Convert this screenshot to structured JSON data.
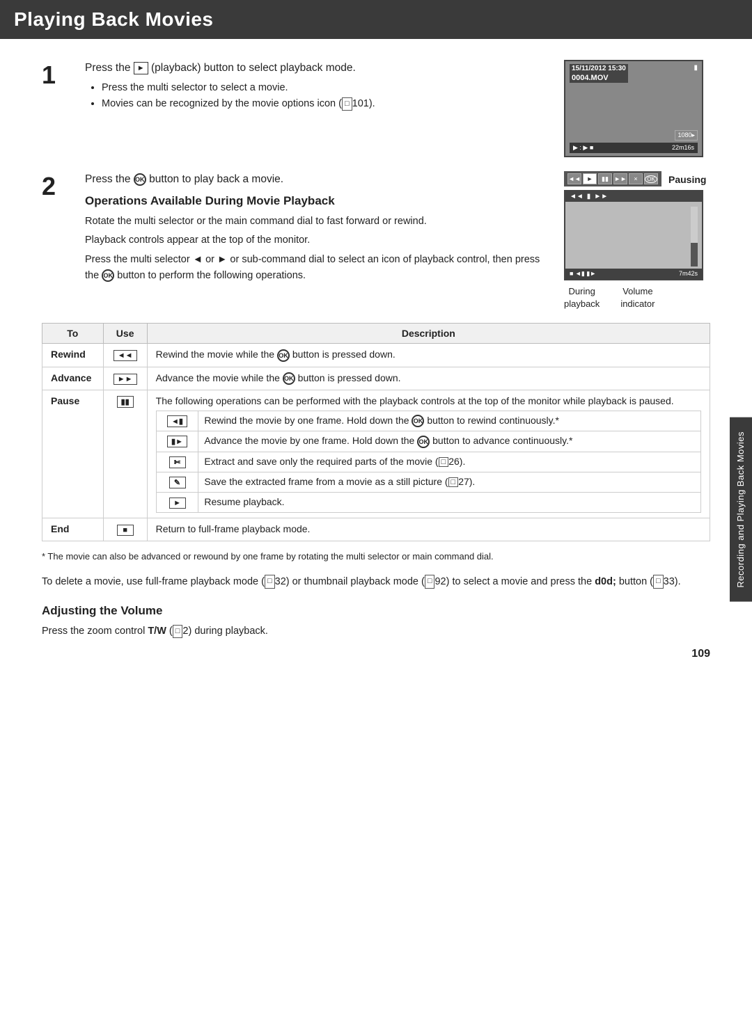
{
  "page": {
    "title": "Playing Back Movies",
    "page_number": "109",
    "sidebar_label": "Recording and Playing Back Movies"
  },
  "step1": {
    "number": "1",
    "text": "Press the ► (playback) button to select playback mode.",
    "bullets": [
      "Press the multi selector to select a movie.",
      "Movies can be recognized by the movie options icon (  101)."
    ],
    "camera": {
      "date": "15/11/2012 15:30",
      "filename": "0004.MOV",
      "bottom_left": "► : ► ■",
      "bottom_right": "22m16s",
      "hd_badge": "1080▸"
    }
  },
  "step2": {
    "number": "2",
    "text": "Press the Ⓢ button to play back a movie.",
    "pausing_label": "Pausing",
    "controls": [
      "◄◄",
      "■",
      "▮▮",
      "×",
      "Ⓢ"
    ],
    "cam2_controls": [
      "◄◄",
      "▮▮",
      "▮▮"
    ],
    "cam2_bottom_left": "■◄▮▶",
    "cam2_bottom_right": "7m42s",
    "image_labels": {
      "left": "During\nplayback",
      "right": "Volume\nindicator"
    }
  },
  "operations": {
    "heading": "Operations Available During Movie Playback",
    "paragraphs": [
      "Rotate the multi selector or the main command dial to fast forward or rewind.",
      "Playback controls appear at the top of the monitor.",
      "Press the multi selector ◄ or ► or sub-command dial to select an icon of playback control, then press the Ⓢ button to perform the following operations."
    ],
    "table": {
      "headers": [
        "To",
        "Use",
        "Description"
      ],
      "rows": [
        {
          "to": "Rewind",
          "use": "◄◄",
          "description": "Rewind the movie while the Ⓢ button is pressed down."
        },
        {
          "to": "Advance",
          "use": "►►",
          "description": "Advance the movie while the Ⓢ button is pressed down."
        },
        {
          "to": "Pause",
          "use": "▮▮",
          "description": "The following operations can be performed with the playback controls at the top of the monitor while playback is paused.",
          "sub_rows": [
            {
              "icon": "◄▮",
              "text": "Rewind the movie by one frame. Hold down the Ⓢ button to rewind continuously.*"
            },
            {
              "icon": "▮►",
              "text": "Advance the movie by one frame. Hold down the Ⓢ button to advance continuously.*"
            },
            {
              "icon": "✂",
              "text": "Extract and save only the required parts of the movie (★☔26)."
            },
            {
              "icon": "⌘",
              "text": "Save the extracted frame from a movie as a still picture (★☔27)."
            },
            {
              "icon": "►",
              "text": "Resume playback."
            }
          ]
        },
        {
          "to": "End",
          "use": "■",
          "description": "Return to full-frame playback mode."
        }
      ]
    }
  },
  "footnote": "* The movie can also be advanced or rewound by one frame by rotating the multi selector or main command dial.",
  "delete_note": "To delete a movie, use full-frame playback mode ( 32) or thumbnail playback mode ( 92) to select a movie and press the ᴍ button ( 33).",
  "volume_section": {
    "heading": "Adjusting the Volume",
    "text": "Press the zoom control T/W ( 2) during playback."
  }
}
